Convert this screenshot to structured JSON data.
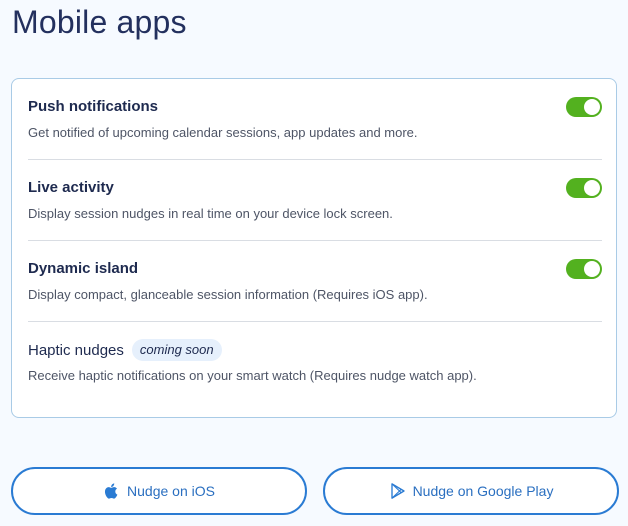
{
  "page": {
    "title": "Mobile apps"
  },
  "settings": [
    {
      "title": "Push notifications",
      "description": "Get notified of upcoming calendar sessions, app updates and more.",
      "enabled": true
    },
    {
      "title": "Live activity",
      "description": "Display session nudges in real time on your device lock screen.",
      "enabled": true
    },
    {
      "title": "Dynamic island",
      "description": "Display compact, glanceable session information (Requires iOS app).",
      "enabled": true
    },
    {
      "title": "Haptic nudges",
      "badge": "coming soon",
      "description": "Receive haptic notifications on your smart watch (Requires nudge watch app)."
    }
  ],
  "buttons": {
    "ios": {
      "label": "Nudge on iOS",
      "icon": "apple-icon"
    },
    "android": {
      "label": "Nudge on Google Play",
      "icon": "google-play-icon"
    }
  },
  "colors": {
    "toggle_on": "#53b11f",
    "accent": "#2a7bd3",
    "title_text": "#23305e"
  }
}
